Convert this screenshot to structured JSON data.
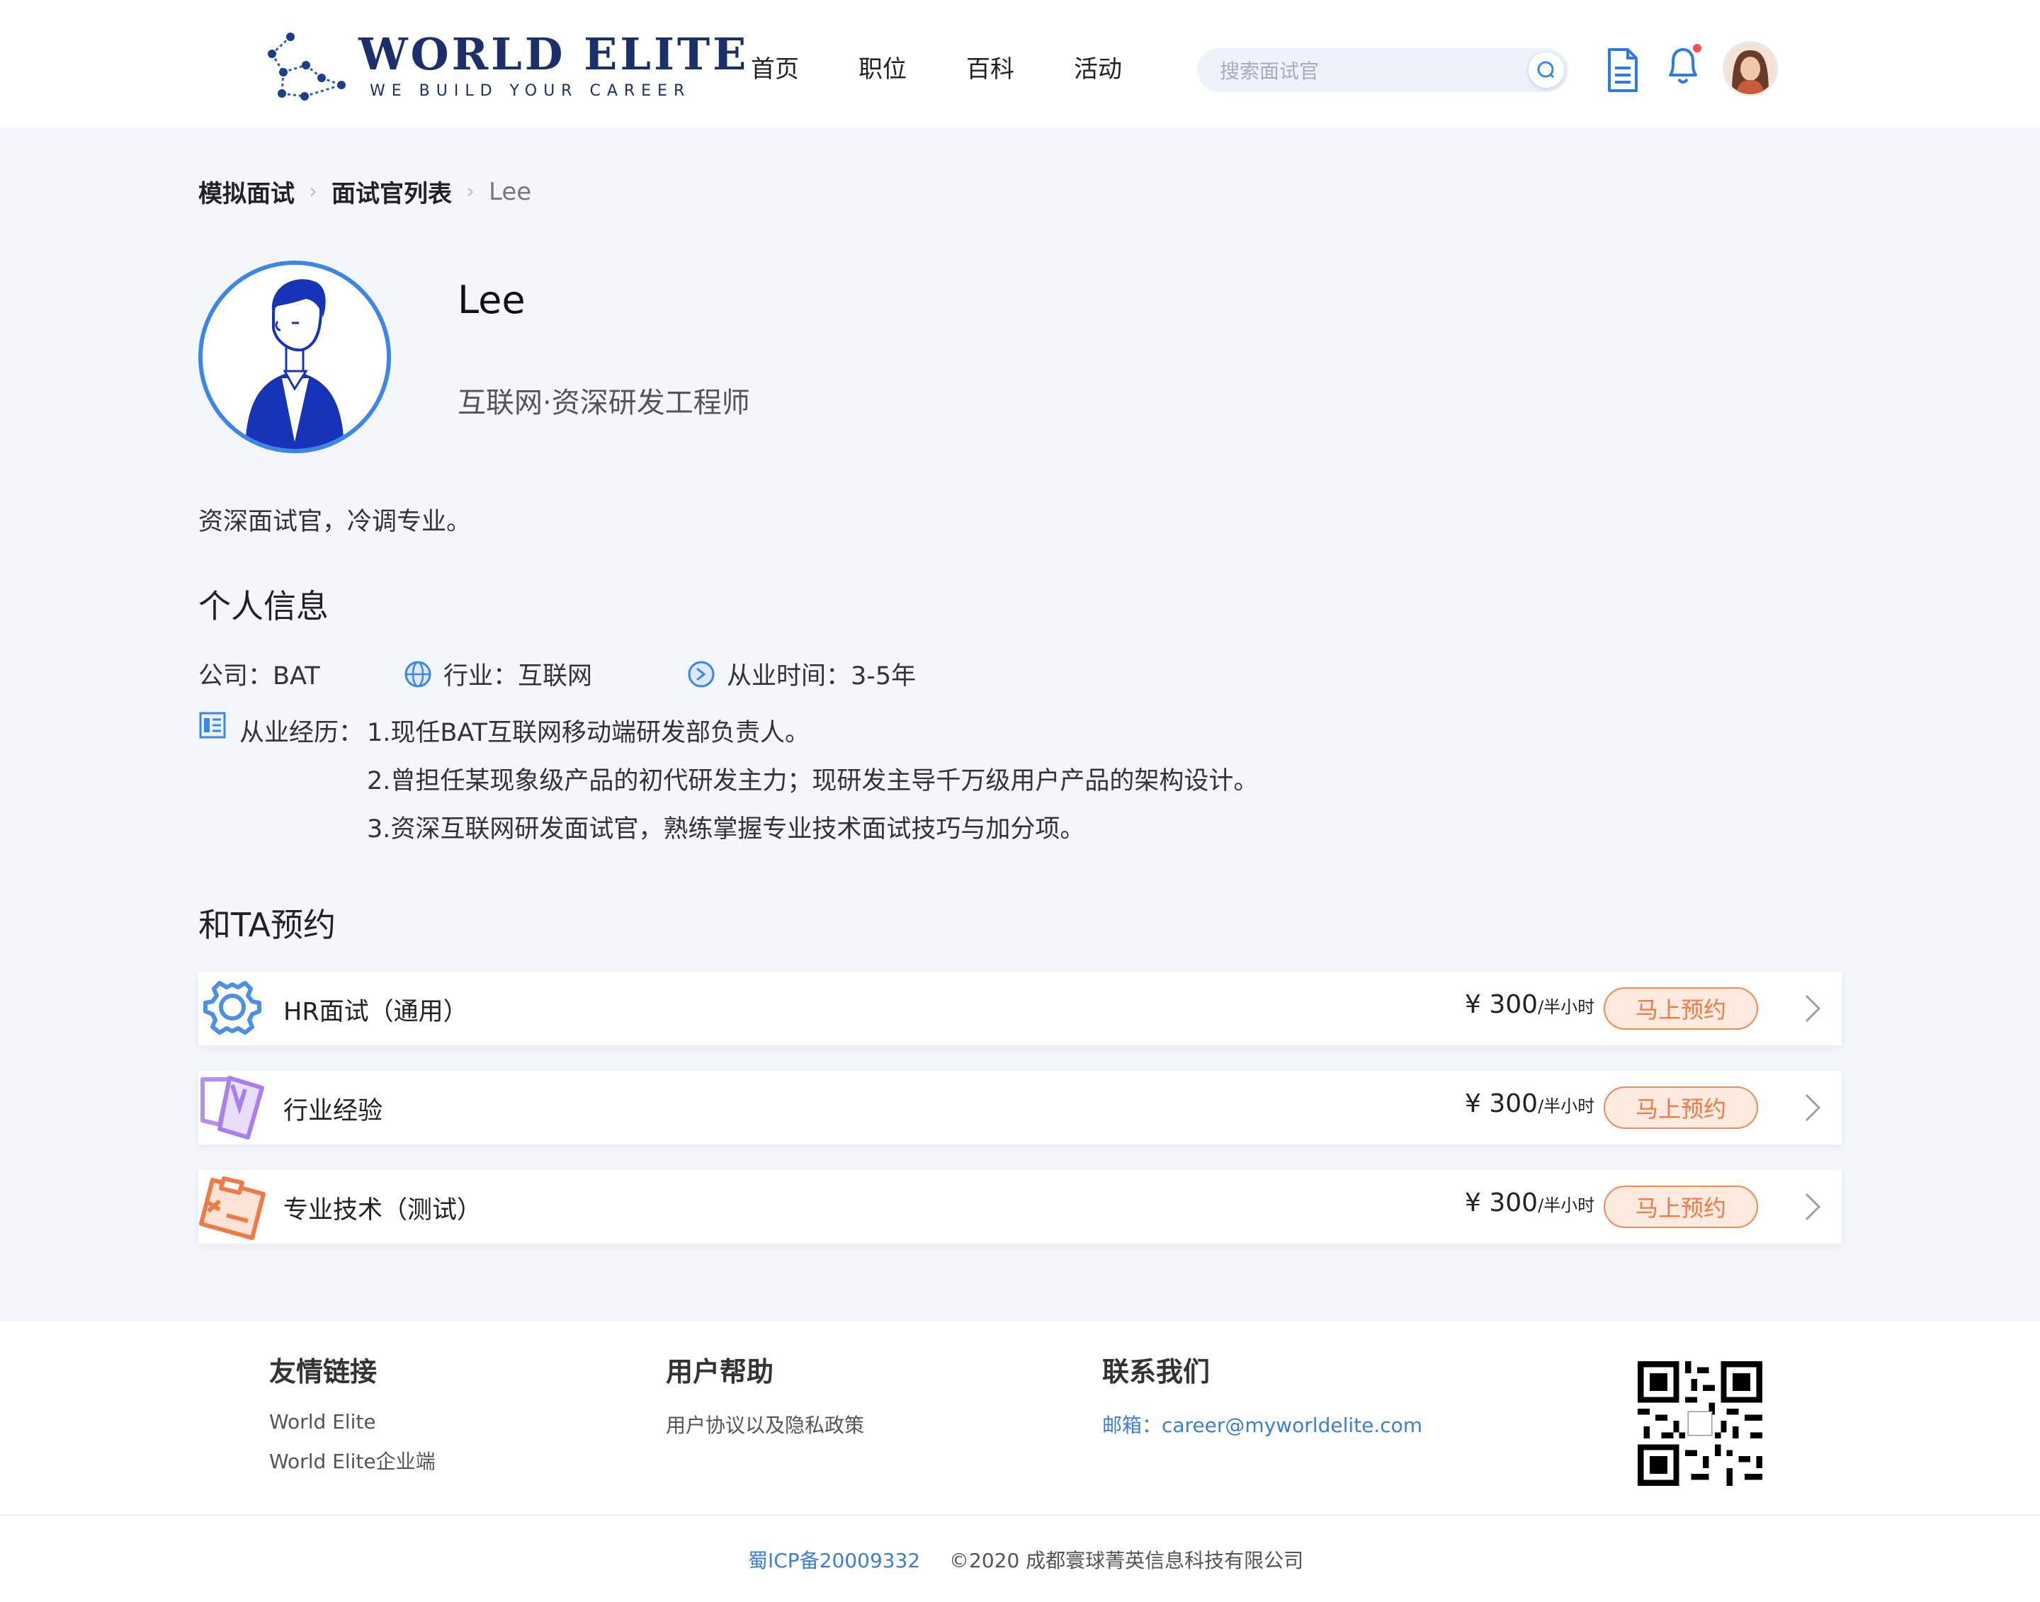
{
  "header": {
    "logo_title": "WORLD ELITE",
    "logo_sub": "WE BUILD YOUR CAREER",
    "nav": [
      "首页",
      "职位",
      "百科",
      "活动"
    ],
    "search_placeholder": "搜索面试官"
  },
  "breadcrumb": {
    "items": [
      "模拟面试",
      "面试官列表"
    ],
    "current": "Lee"
  },
  "profile": {
    "name": "Lee",
    "title": "互联网·资深研发工程师",
    "description": "资深面试官，冷调专业。"
  },
  "personal_info": {
    "heading": "个人信息",
    "company": "公司：BAT",
    "industry": "行业：互联网",
    "years": "从业时间：3-5年",
    "experience_label": "从业经历：",
    "experience": [
      "1.现任BAT互联网移动端研发部负责人。",
      "2.曾担任某现象级产品的初代研发主力；现研发主导千万级用户产品的架构设计。",
      "3.资深互联网研发面试官，熟练掌握专业技术面试技巧与加分项。"
    ]
  },
  "booking": {
    "heading": "和TA预约",
    "services": [
      {
        "name": "HR面试（通用）",
        "price": "¥ 300",
        "unit": "/半小时",
        "button": "马上预约"
      },
      {
        "name": "行业经验",
        "price": "¥ 300",
        "unit": "/半小时",
        "button": "马上预约"
      },
      {
        "name": "专业技术（测试）",
        "price": "¥ 300",
        "unit": "/半小时",
        "button": "马上预约"
      }
    ]
  },
  "footer": {
    "links_heading": "友情链接",
    "links": [
      "World Elite",
      "World Elite企业端"
    ],
    "help_heading": "用户帮助",
    "help": [
      "用户协议以及隐私政策"
    ],
    "contact_heading": "联系我们",
    "email": "邮箱：career@myworldelite.com",
    "icp": "蜀ICP备20009332",
    "copyright": "©2020 成都寰球菁英信息科技有限公司"
  },
  "colors": {
    "accent": "#3b86e6",
    "brand": "#1b2f6b",
    "button": "#f07a45",
    "notify": "#ff4d4f"
  }
}
